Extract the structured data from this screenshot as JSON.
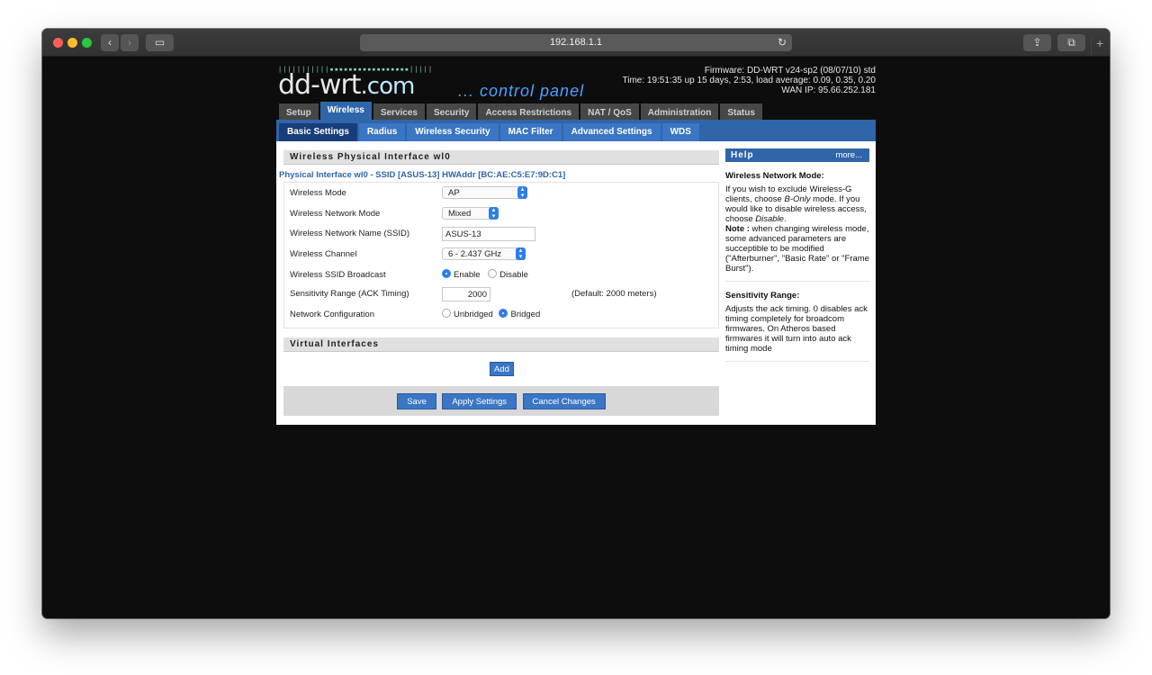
{
  "browser": {
    "url": "192.168.1.1"
  },
  "header": {
    "logo_dots": "|||||||||||▪▪▪▪▪▪▪▪▪▪▪▪▪▪▪▪▪|||||",
    "logo_main": "dd-wrt",
    "logo_com": ".com",
    "logo_tagline": "... control panel",
    "firmware": "Firmware: DD-WRT v24-sp2 (08/07/10) std",
    "time": "Time: 19:51:35 up 15 days, 2:53, load average: 0.09, 0.35, 0.20",
    "wan_ip": "WAN IP: 95.66.252.181"
  },
  "main_tabs": [
    "Setup",
    "Wireless",
    "Services",
    "Security",
    "Access Restrictions",
    "NAT / QoS",
    "Administration",
    "Status"
  ],
  "sub_tabs": [
    "Basic Settings",
    "Radius",
    "Wireless Security",
    "MAC Filter",
    "Advanced Settings",
    "WDS"
  ],
  "section_physical": {
    "title": "Wireless Physical Interface wl0",
    "interface_line": "Physical Interface wl0 - SSID [ASUS-13] HWAddr [BC:AE:C5:E7:9D:C1]"
  },
  "fields": {
    "mode_label": "Wireless Mode",
    "mode_value": "AP",
    "net_mode_label": "Wireless Network Mode",
    "net_mode_value": "Mixed",
    "ssid_label": "Wireless Network Name (SSID)",
    "ssid_value": "ASUS-13",
    "channel_label": "Wireless Channel",
    "channel_value": "6 - 2.437 GHz",
    "broadcast_label": "Wireless SSID Broadcast",
    "broadcast_enable": "Enable",
    "broadcast_disable": "Disable",
    "sens_label": "Sensitivity Range (ACK Timing)",
    "sens_value": "2000",
    "sens_default": "(Default: 2000 meters)",
    "netconf_label": "Network Configuration",
    "netconf_unbridged": "Unbridged",
    "netconf_bridged": "Bridged"
  },
  "section_virtual": {
    "title": "Virtual Interfaces",
    "add_label": "Add"
  },
  "actions": {
    "save": "Save",
    "apply": "Apply Settings",
    "cancel": "Cancel Changes"
  },
  "help": {
    "title": "Help",
    "more": "more...",
    "mode_title": "Wireless Network Mode:",
    "mode_text1": "If you wish to exclude Wireless-G clients, choose ",
    "mode_em1": "B-Only",
    "mode_text2": " mode. If you would like to disable wireless access, choose ",
    "mode_em2": "Disable",
    "mode_text3": ".",
    "note_label": "Note :",
    "note_text": " when changing wireless mode, some advanced parameters are succeptible to be modified (\"Afterburner\", \"Basic Rate\" or \"Frame Burst\").",
    "sens_title": "Sensitivity Range:",
    "sens_text": "Adjusts the ack timing. 0 disables ack timing completely for broadcom firmwares. On Atheros based firmwares it will turn into auto ack timing mode"
  }
}
